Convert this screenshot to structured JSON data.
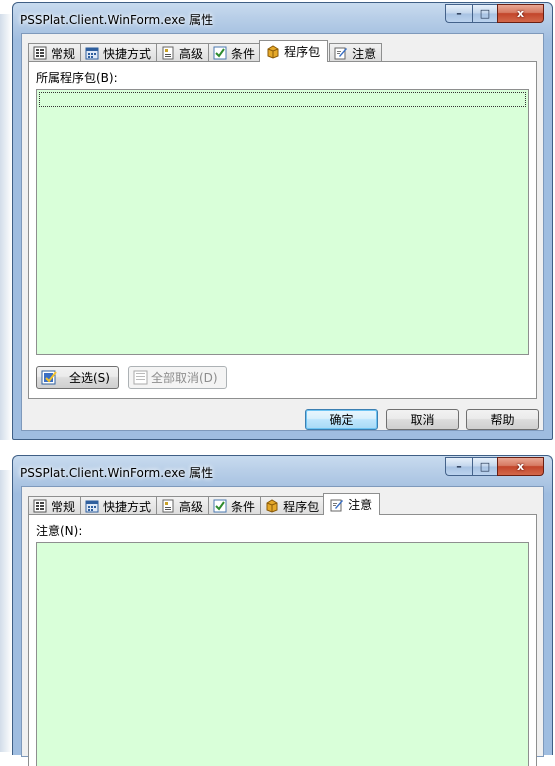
{
  "windows": [
    {
      "title": "PSSPlat.Client.WinForm.exe 属性",
      "tabs": [
        {
          "label": "常规",
          "icon": "general-icon",
          "active": false
        },
        {
          "label": "快捷方式",
          "icon": "shortcut-icon",
          "active": false
        },
        {
          "label": "高级",
          "icon": "advanced-icon",
          "active": false
        },
        {
          "label": "条件",
          "icon": "conditions-icon",
          "active": false
        },
        {
          "label": "程序包",
          "icon": "package-icon",
          "active": true
        },
        {
          "label": "注意",
          "icon": "note-icon",
          "active": false
        }
      ],
      "package_label": "所属程序包(B):",
      "select_all": "全选(S)",
      "deselect_all": "全部取消(D)",
      "ok": "确定",
      "cancel": "取消",
      "help": "帮助"
    },
    {
      "title": "PSSPlat.Client.WinForm.exe 属性",
      "tabs": [
        {
          "label": "常规",
          "icon": "general-icon",
          "active": false
        },
        {
          "label": "快捷方式",
          "icon": "shortcut-icon",
          "active": false
        },
        {
          "label": "高级",
          "icon": "advanced-icon",
          "active": false
        },
        {
          "label": "条件",
          "icon": "conditions-icon",
          "active": false
        },
        {
          "label": "程序包",
          "icon": "package-icon",
          "active": false
        },
        {
          "label": "注意",
          "icon": "note-icon",
          "active": true
        }
      ],
      "note_label": "注意(N):"
    }
  ],
  "caption_glyphs": {
    "minimize": "–",
    "maximize": "□",
    "close": "x"
  },
  "colors": {
    "list_background": "#d9ffd9",
    "title_bar": "#b9cfe8",
    "default_button": "#bee6fd"
  }
}
